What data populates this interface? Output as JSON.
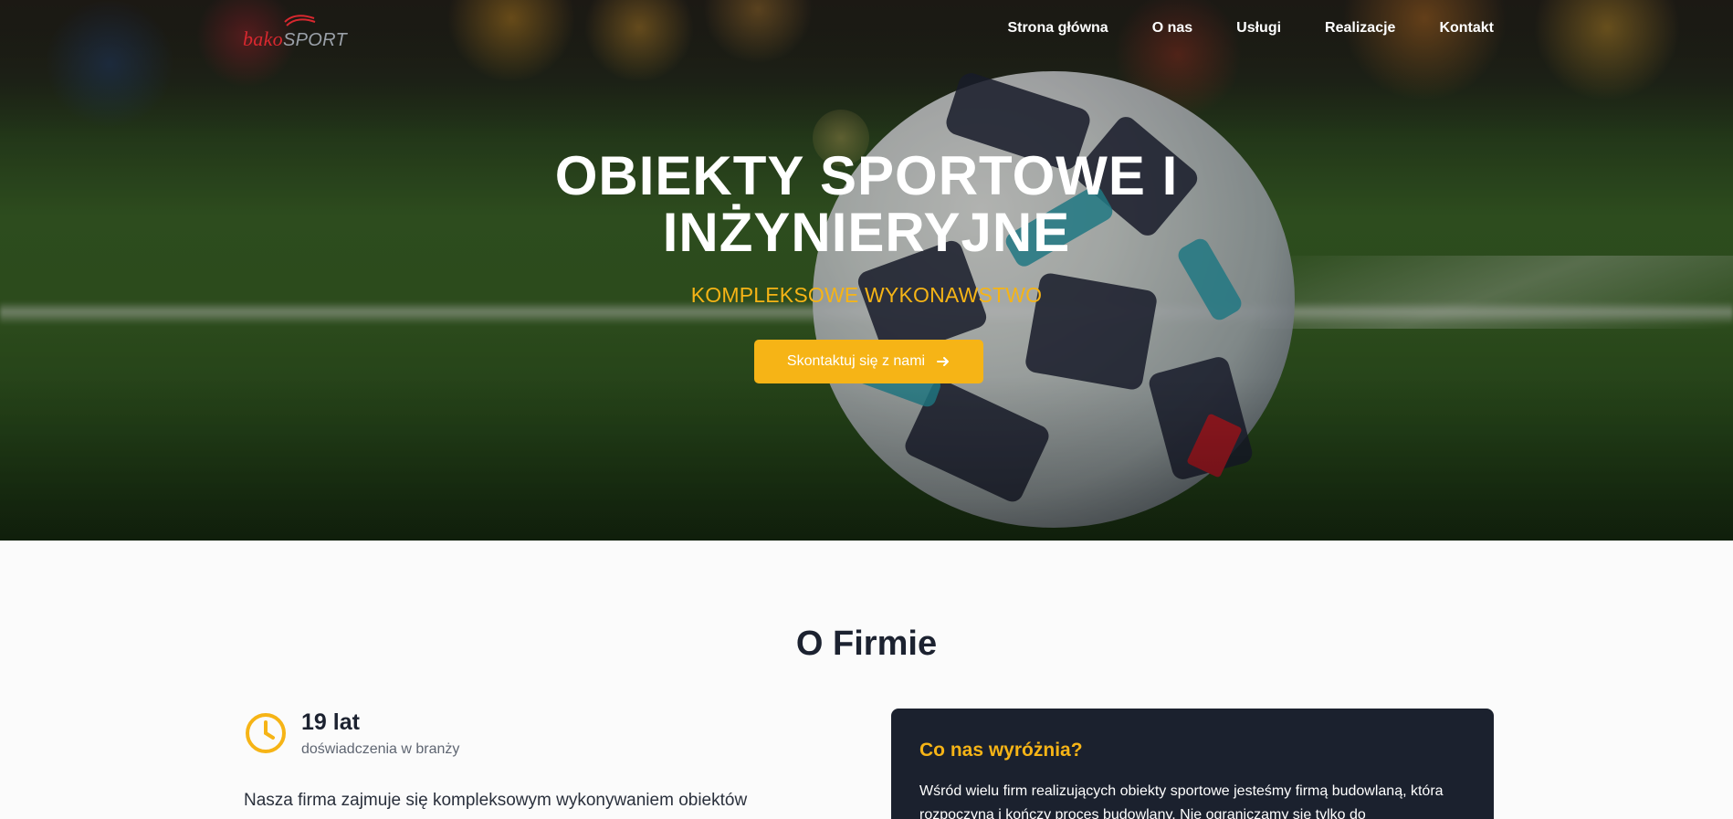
{
  "brand": {
    "logo_part1": "bako",
    "logo_part2": "SPORT"
  },
  "nav": {
    "items": [
      "Strona główna",
      "O nas",
      "Usługi",
      "Realizacje",
      "Kontakt"
    ]
  },
  "hero": {
    "title_line1": "OBIEKTY SPORTOWE I",
    "title_line2": "INŻYNIERYJNE",
    "subtitle": "KOMPLEKSOWE WYKONAWSTWO",
    "cta_label": "Skontaktuj się z nami"
  },
  "about": {
    "title": "O Firmie",
    "stat_value": "19 lat",
    "stat_label": "doświadczenia w branży",
    "paragraph": "Nasza firma zajmuje się kompleksowym wykonywaniem obiektów"
  },
  "highlight_card": {
    "title": "Co nas wyróżnia?",
    "body": "Wśród wielu firm realizujących obiekty sportowe jesteśmy firmą budowlaną, która rozpoczyna i kończy proces budowlany. Nie ograniczamy się tylko do"
  },
  "colors": {
    "accent": "#f6b416",
    "dark": "#1b212e",
    "logo_red": "#d8282f"
  },
  "icons": {
    "logo_swoosh": "swoosh-icon",
    "cta": "arrow-right-icon",
    "stat": "clock-icon"
  }
}
